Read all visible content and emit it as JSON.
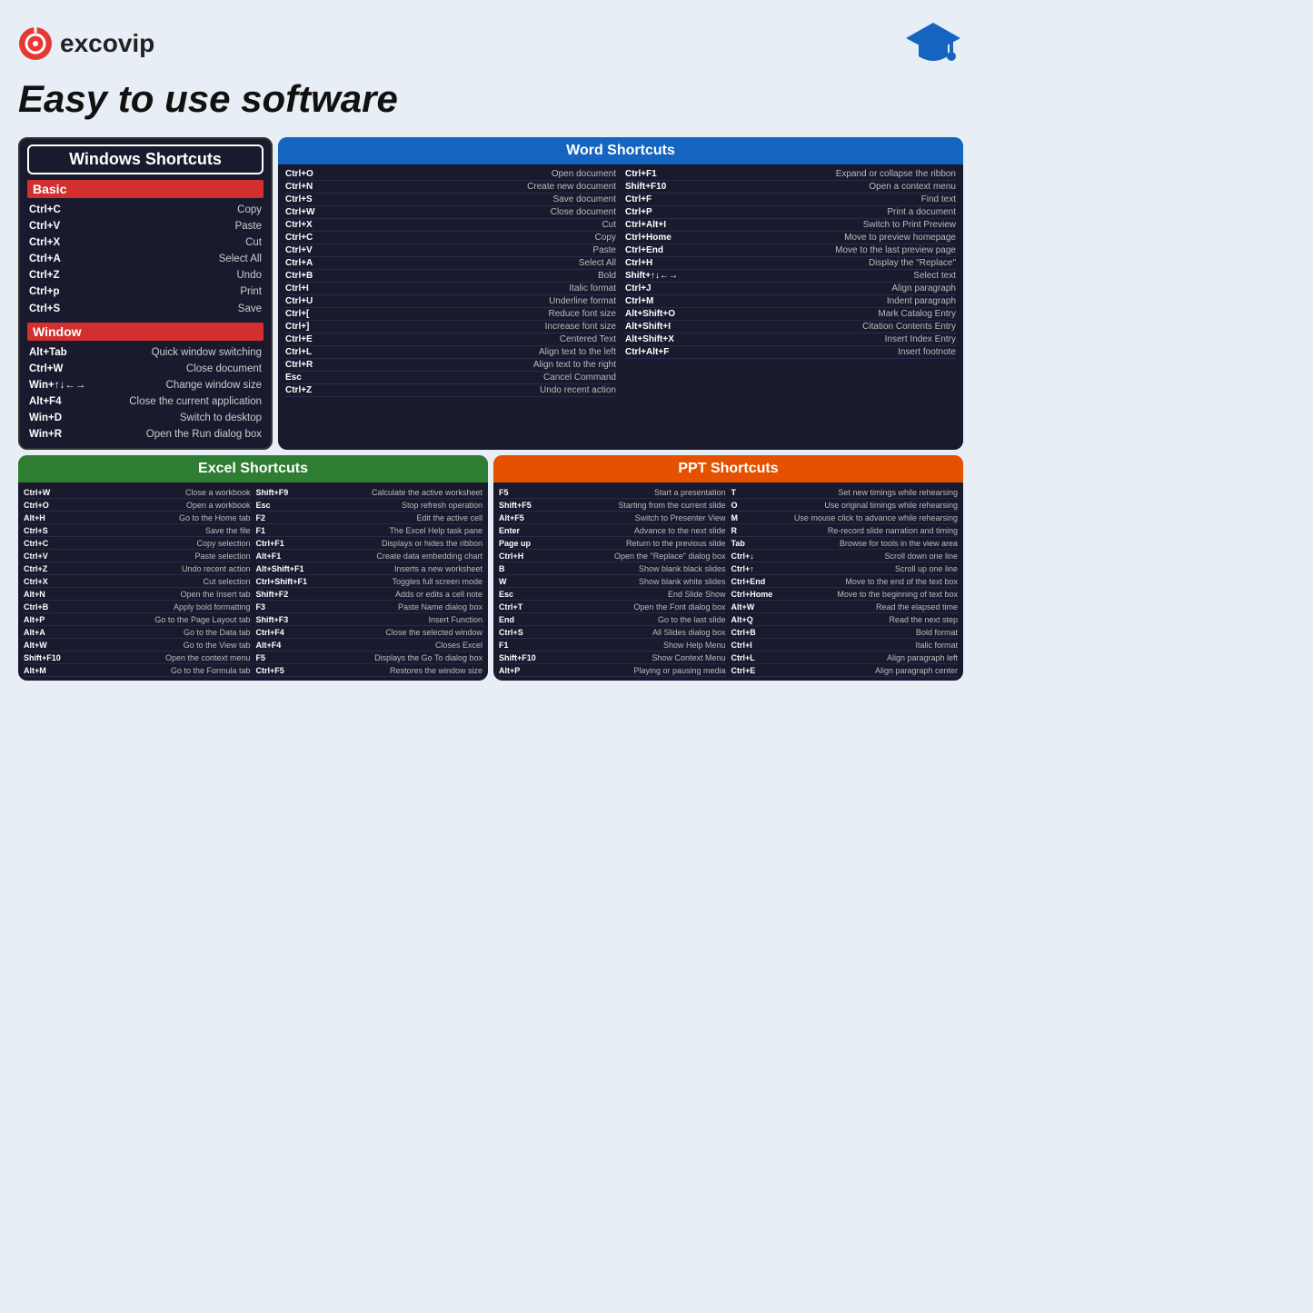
{
  "header": {
    "logo_text": "excovip",
    "tagline": "Easy to use software"
  },
  "windows": {
    "title": "Windows Shortcuts",
    "basic_label": "Basic",
    "basic_shortcuts": [
      {
        "key": "Ctrl+C",
        "desc": "Copy"
      },
      {
        "key": "Ctrl+V",
        "desc": "Paste"
      },
      {
        "key": "Ctrl+X",
        "desc": "Cut"
      },
      {
        "key": "Ctrl+A",
        "desc": "Select All"
      },
      {
        "key": "Ctrl+Z",
        "desc": "Undo"
      },
      {
        "key": "Ctrl+p",
        "desc": "Print"
      },
      {
        "key": "Ctrl+S",
        "desc": "Save"
      }
    ],
    "window_label": "Window",
    "window_shortcuts": [
      {
        "key": "Alt+Tab",
        "desc": "Quick window switching"
      },
      {
        "key": "Ctrl+W",
        "desc": "Close document"
      },
      {
        "key": "Win+↑↓←→",
        "desc": "Change window size"
      },
      {
        "key": "Alt+F4",
        "desc": "Close the current application"
      },
      {
        "key": "Win+D",
        "desc": "Switch to desktop"
      },
      {
        "key": "Win+R",
        "desc": "Open the Run dialog box"
      }
    ]
  },
  "word_top": {
    "title": "Word Shortcuts",
    "left_col": [
      {
        "key": "Ctrl+O",
        "desc": "Open document"
      },
      {
        "key": "Ctrl+N",
        "desc": "Create new document"
      },
      {
        "key": "Ctrl+S",
        "desc": "Save document"
      },
      {
        "key": "Ctrl+W",
        "desc": "Close document"
      },
      {
        "key": "Ctrl+X",
        "desc": "Cut"
      },
      {
        "key": "Ctrl+C",
        "desc": "Copy"
      },
      {
        "key": "Ctrl+V",
        "desc": "Paste"
      },
      {
        "key": "Ctrl+A",
        "desc": "Select All"
      },
      {
        "key": "Ctrl+B",
        "desc": "Bold"
      },
      {
        "key": "Ctrl+I",
        "desc": "Italic format"
      },
      {
        "key": "Ctrl+U",
        "desc": "Underline format"
      },
      {
        "key": "Ctrl+[",
        "desc": "Reduce font size"
      },
      {
        "key": "Ctrl+]",
        "desc": "Increase font size"
      },
      {
        "key": "Ctrl+E",
        "desc": "Centered Text"
      },
      {
        "key": "Ctrl+L",
        "desc": "Align text to the left"
      },
      {
        "key": "Ctrl+R",
        "desc": "Align text to the right"
      },
      {
        "key": "Esc",
        "desc": "Cancel Command"
      },
      {
        "key": "Ctrl+Z",
        "desc": "Undo recent action"
      }
    ],
    "right_col": [
      {
        "key": "Ctrl+F1",
        "desc": "Expand or collapse the ribbon"
      },
      {
        "key": "Shift+F10",
        "desc": "Open a context menu"
      },
      {
        "key": "Ctrl+F",
        "desc": "Find text"
      },
      {
        "key": "Ctrl+P",
        "desc": "Print a document"
      },
      {
        "key": "Ctrl+Alt+I",
        "desc": "Switch to Print Preview"
      },
      {
        "key": "Ctrl+Home",
        "desc": "Move to preview homepage"
      },
      {
        "key": "Ctrl+End",
        "desc": "Move to the last preview page"
      },
      {
        "key": "Ctrl+H",
        "desc": "Display the \"Replace\""
      },
      {
        "key": "Shift+↑↓←→",
        "desc": "Select text"
      },
      {
        "key": "Ctrl+J",
        "desc": "Align paragraph"
      },
      {
        "key": "Ctrl+M",
        "desc": "Indent paragraph"
      },
      {
        "key": "Alt+Shift+O",
        "desc": "Mark Catalog Entry"
      },
      {
        "key": "Alt+Shift+I",
        "desc": "Citation Contents Entry"
      },
      {
        "key": "Alt+Shift+X",
        "desc": "Insert Index Entry"
      },
      {
        "key": "Ctrl+Alt+F",
        "desc": "Insert footnote"
      }
    ]
  },
  "excel": {
    "title": "Excel Shortcuts",
    "col1": [
      {
        "key": "Ctrl+W",
        "desc": "Close a workbook"
      },
      {
        "key": "Ctrl+O",
        "desc": "Open a workbook"
      },
      {
        "key": "Alt+H",
        "desc": "Go to the Home tab"
      },
      {
        "key": "Ctrl+S",
        "desc": "Save the file"
      },
      {
        "key": "Ctrl+C",
        "desc": "Copy selection"
      },
      {
        "key": "Ctrl+V",
        "desc": "Paste selection"
      },
      {
        "key": "Ctrl+Z",
        "desc": "Undo recent action"
      },
      {
        "key": "Ctrl+X",
        "desc": "Cut selection"
      },
      {
        "key": "Alt+N",
        "desc": "Open the Insert tab"
      },
      {
        "key": "Ctrl+B",
        "desc": "Apply bold formatting"
      },
      {
        "key": "Alt+P",
        "desc": "Go to the Page Layout tab"
      },
      {
        "key": "Alt+A",
        "desc": "Go to the Data tab"
      },
      {
        "key": "Alt+W",
        "desc": "Go to the View tab"
      },
      {
        "key": "Shift+F10",
        "desc": "Open the context menu"
      },
      {
        "key": "Alt+M",
        "desc": "Go to the Formula tab"
      }
    ],
    "col2": [
      {
        "key": "Shift+F9",
        "desc": "Calculate the active worksheet"
      },
      {
        "key": "Esc",
        "desc": "Stop refresh operation"
      },
      {
        "key": "F2",
        "desc": "Edit the active cell"
      },
      {
        "key": "F1",
        "desc": "The Excel Help task pane"
      },
      {
        "key": "Ctrl+F1",
        "desc": "Displays or hides the ribbon"
      },
      {
        "key": "Alt+F1",
        "desc": "Create data embedding chart"
      },
      {
        "key": "Alt+Shift+F1",
        "desc": "Inserts a new worksheet"
      },
      {
        "key": "Ctrl+Shift+F1",
        "desc": "Toggles full screen mode"
      },
      {
        "key": "Shift+F2",
        "desc": "Adds or edits a cell note"
      },
      {
        "key": "F3",
        "desc": "Paste Name dialog box"
      },
      {
        "key": "Shift+F3",
        "desc": "Insert Function"
      },
      {
        "key": "Ctrl+F4",
        "desc": "Close the selected window"
      },
      {
        "key": "Alt+F4",
        "desc": "Closes Excel"
      },
      {
        "key": "F5",
        "desc": "Displays the Go To dialog box"
      },
      {
        "key": "Ctrl+F5",
        "desc": "Restores the window size"
      }
    ]
  },
  "ppt": {
    "title": "PPT Shortcuts",
    "col1": [
      {
        "key": "F5",
        "desc": "Start a presentation"
      },
      {
        "key": "Shift+F5",
        "desc": "Starting from the current slide"
      },
      {
        "key": "Alt+F5",
        "desc": "Switch to Presenter View"
      },
      {
        "key": "Enter",
        "desc": "Advance to the next slide"
      },
      {
        "key": "Page up",
        "desc": "Return to the previous slide"
      },
      {
        "key": "Ctrl+H",
        "desc": "Open the \"Replace\" dialog box"
      },
      {
        "key": "B",
        "desc": "Show blank black slides"
      },
      {
        "key": "W",
        "desc": "Show blank white slides"
      },
      {
        "key": "Esc",
        "desc": "End Slide Show"
      },
      {
        "key": "Ctrl+T",
        "desc": "Open the Font dialog box"
      },
      {
        "key": "End",
        "desc": "Go to the last slide"
      },
      {
        "key": "Ctrl+S",
        "desc": "All Slides dialog box"
      },
      {
        "key": "F1",
        "desc": "Show Help Menu"
      },
      {
        "key": "Shift+F10",
        "desc": "Show Context Menu"
      },
      {
        "key": "Alt+P",
        "desc": "Playing or pausing media"
      }
    ],
    "col2": [
      {
        "key": "T",
        "desc": "Set new timings while rehearsing"
      },
      {
        "key": "O",
        "desc": "Use original timings while rehearsing"
      },
      {
        "key": "M",
        "desc": "Use mouse click to advance while rehearsing"
      },
      {
        "key": "R",
        "desc": "Re-record slide narration and timing"
      },
      {
        "key": "Tab",
        "desc": "Browse for tools in the view area"
      },
      {
        "key": "Ctrl+↓",
        "desc": "Scroll down one line"
      },
      {
        "key": "Ctrl+↑",
        "desc": "Scroll up one line"
      },
      {
        "key": "Ctrl+End",
        "desc": "Move to the end of the text box"
      },
      {
        "key": "Ctrl+Home",
        "desc": "Move to the beginning of text box"
      },
      {
        "key": "Alt+W",
        "desc": "Read the elapsed time"
      },
      {
        "key": "Alt+Q",
        "desc": "Read the next step"
      },
      {
        "key": "Ctrl+B",
        "desc": "Bold format"
      },
      {
        "key": "Ctrl+I",
        "desc": "Italic format"
      },
      {
        "key": "Ctrl+L",
        "desc": "Align paragraph left"
      },
      {
        "key": "Ctrl+E",
        "desc": "Align paragraph center"
      }
    ]
  }
}
